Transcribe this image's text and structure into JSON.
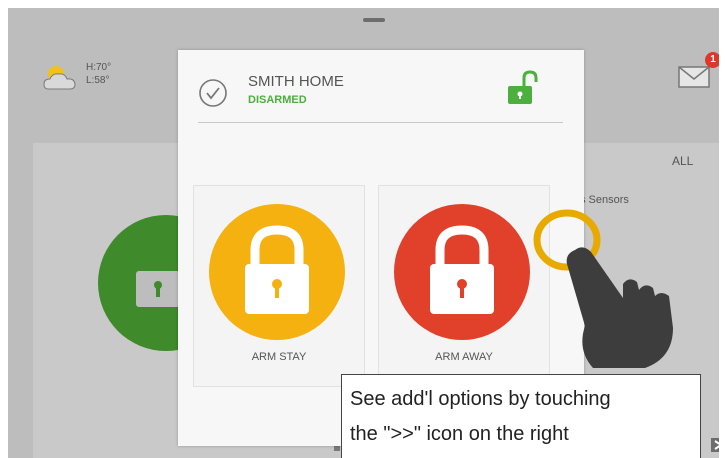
{
  "weather": {
    "icon": "partly-cloudy-icon",
    "high": "H:70°",
    "low": "L:58°"
  },
  "header": {
    "mail_icon": "mail-icon",
    "mail_badge": "1"
  },
  "background": {
    "filter_label": "ALL",
    "sensors_label": "s Sensors"
  },
  "modal": {
    "home_name": "SMITH HOME",
    "status": "DISARMED",
    "status_color": "#4caf3e",
    "arm_stay": {
      "label": "ARM STAY",
      "color": "#f4b10f",
      "icon": "lock-icon"
    },
    "arm_away": {
      "label": "ARM AWAY",
      "color": "#e1402b",
      "icon": "lock-icon"
    }
  },
  "callout": {
    "line1": "See add'l options by touching",
    "line2": "the \">>\" icon on the right"
  },
  "colors": {
    "accent_green": "#4caf3e",
    "highlight_ring": "#e8a900",
    "hand": "#3d3d3d"
  }
}
